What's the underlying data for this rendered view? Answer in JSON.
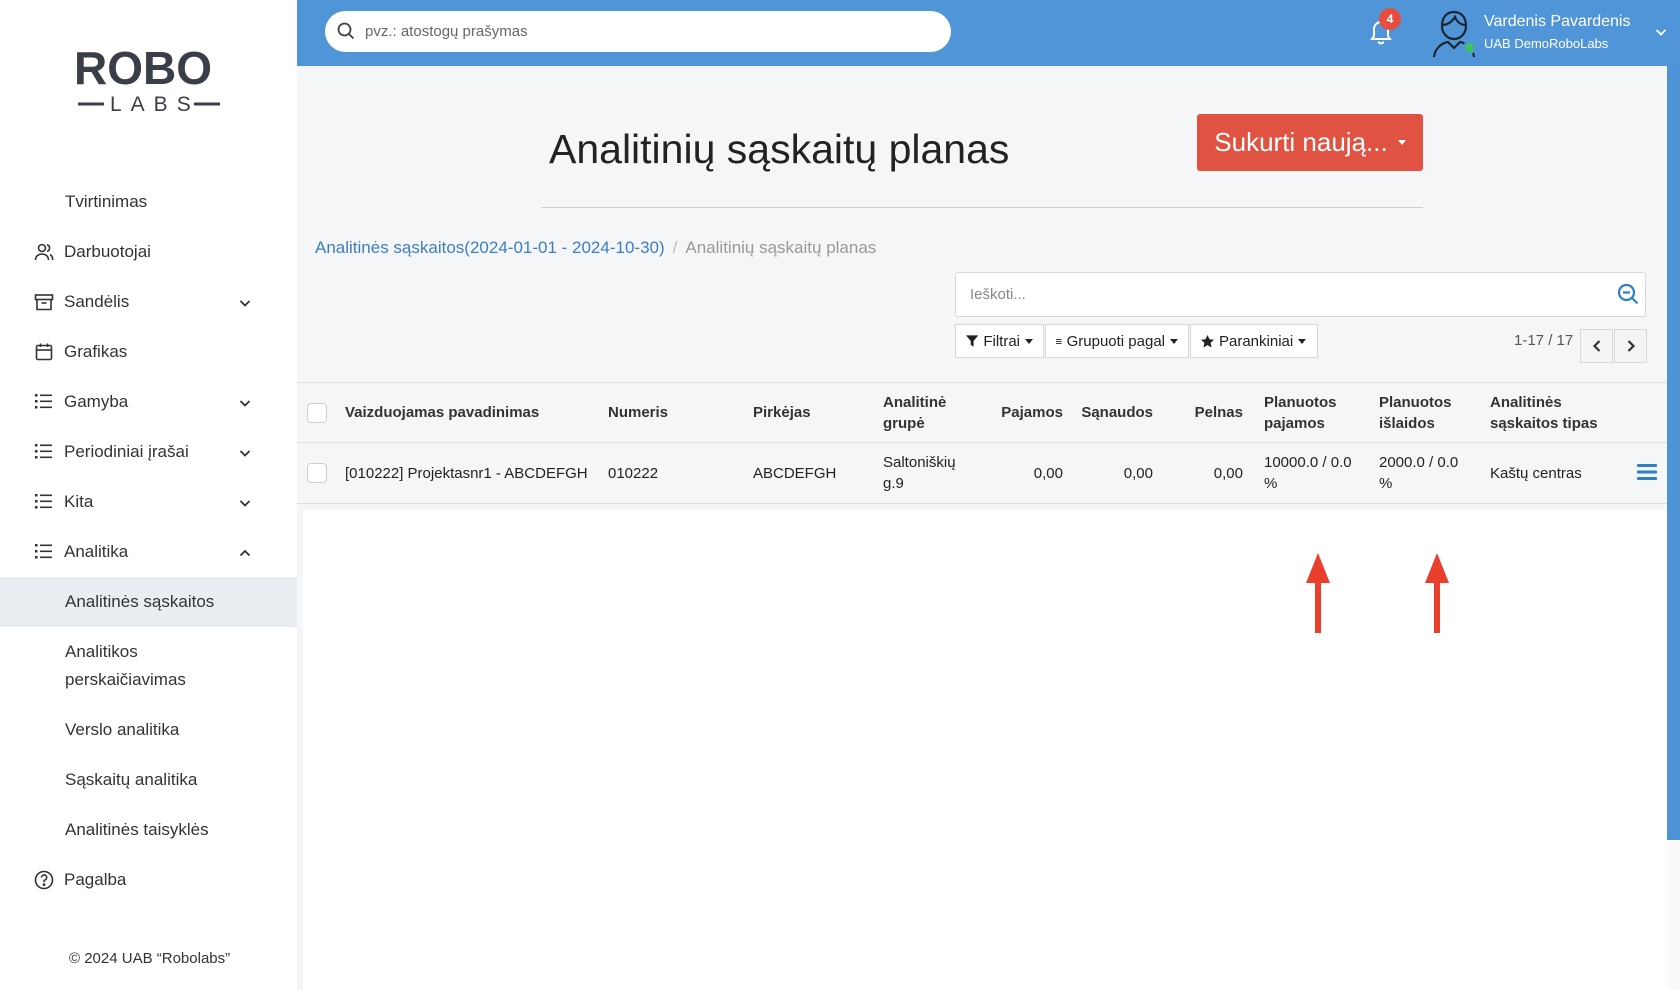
{
  "logo": {
    "text_top": "ROBO",
    "text_bottom": "LABS"
  },
  "sidebar": {
    "items": [
      {
        "label": "Tvirtinimas",
        "icon": "none"
      },
      {
        "label": "Darbuotojai",
        "icon": "users-icon"
      },
      {
        "label": "Sandėlis",
        "icon": "archive-icon",
        "expand": "down"
      },
      {
        "label": "Grafikas",
        "icon": "calendar-icon"
      },
      {
        "label": "Gamyba",
        "icon": "list-icon",
        "expand": "down"
      },
      {
        "label": "Periodiniai įrašai",
        "icon": "list-icon",
        "expand": "down"
      },
      {
        "label": "Kita",
        "icon": "list-icon",
        "expand": "down"
      },
      {
        "label": "Analitika",
        "icon": "list-icon",
        "expand": "up"
      },
      {
        "label": "Analitinės sąskaitos",
        "active": true
      },
      {
        "label_line1": "Analitikos",
        "label_line2": "perskaičiavimas"
      },
      {
        "label": "Verslo analitika"
      },
      {
        "label": "Sąskaitų analitika"
      },
      {
        "label": "Analitinės taisyklės"
      },
      {
        "label": "Pagalba",
        "icon": "help-icon"
      }
    ],
    "footer": "© 2024 UAB “Robolabs”"
  },
  "topbar": {
    "search_placeholder": "pvz.: atostogų prašymas",
    "notification_count": "4",
    "user_name": "Vardenis Pavardenis",
    "user_company": "UAB DemoRoboLabs"
  },
  "main": {
    "title": "Analitinių sąskaitų planas",
    "create_button": "Sukurti naują...",
    "breadcrumb": {
      "link": "Analitinės sąskaitos(2024-01-01 - 2024-10-30)",
      "current": "Analitinių sąskaitų planas"
    },
    "list_search_placeholder": "Ieškoti...",
    "filters": {
      "filter": "Filtrai",
      "group": "Grupuoti pagal",
      "favorites": "Parankiniai"
    },
    "pager": "1-17 / 17"
  },
  "table": {
    "headers": {
      "name": "Vaizduojamas pavadinimas",
      "number": "Numeris",
      "buyer": "Pirkėjas",
      "group_l1": "Analitinė",
      "group_l2": "grupė",
      "income": "Pajamos",
      "costs": "Sąnaudos",
      "profit": "Pelnas",
      "planned_income_l1": "Planuotos",
      "planned_income_l2": "pajamos",
      "planned_expenses_l1": "Planuotos",
      "planned_expenses_l2": "išlaidos",
      "type_l1": "Analitinės",
      "type_l2": "sąskaitos tipas"
    },
    "rows": [
      {
        "name": "[010222] Projektasnr1 - ABCDEFGH",
        "number": "010222",
        "buyer": "ABCDEFGH",
        "group_l1": "Saltoniškių",
        "group_l2": "g.9",
        "income": "0,00",
        "costs": "0,00",
        "profit": "0,00",
        "planned_income_l1": "10000.0 / 0.0",
        "planned_income_l2": "%",
        "planned_expenses_l1": "2000.0 / 0.0",
        "planned_expenses_l2": "%",
        "type": "Kaštų centras"
      }
    ]
  },
  "colors": {
    "topbar": "#5095d8",
    "primary_button": "#e05242",
    "annotation_arrow": "#e8402c",
    "link": "#3c7ec2"
  }
}
